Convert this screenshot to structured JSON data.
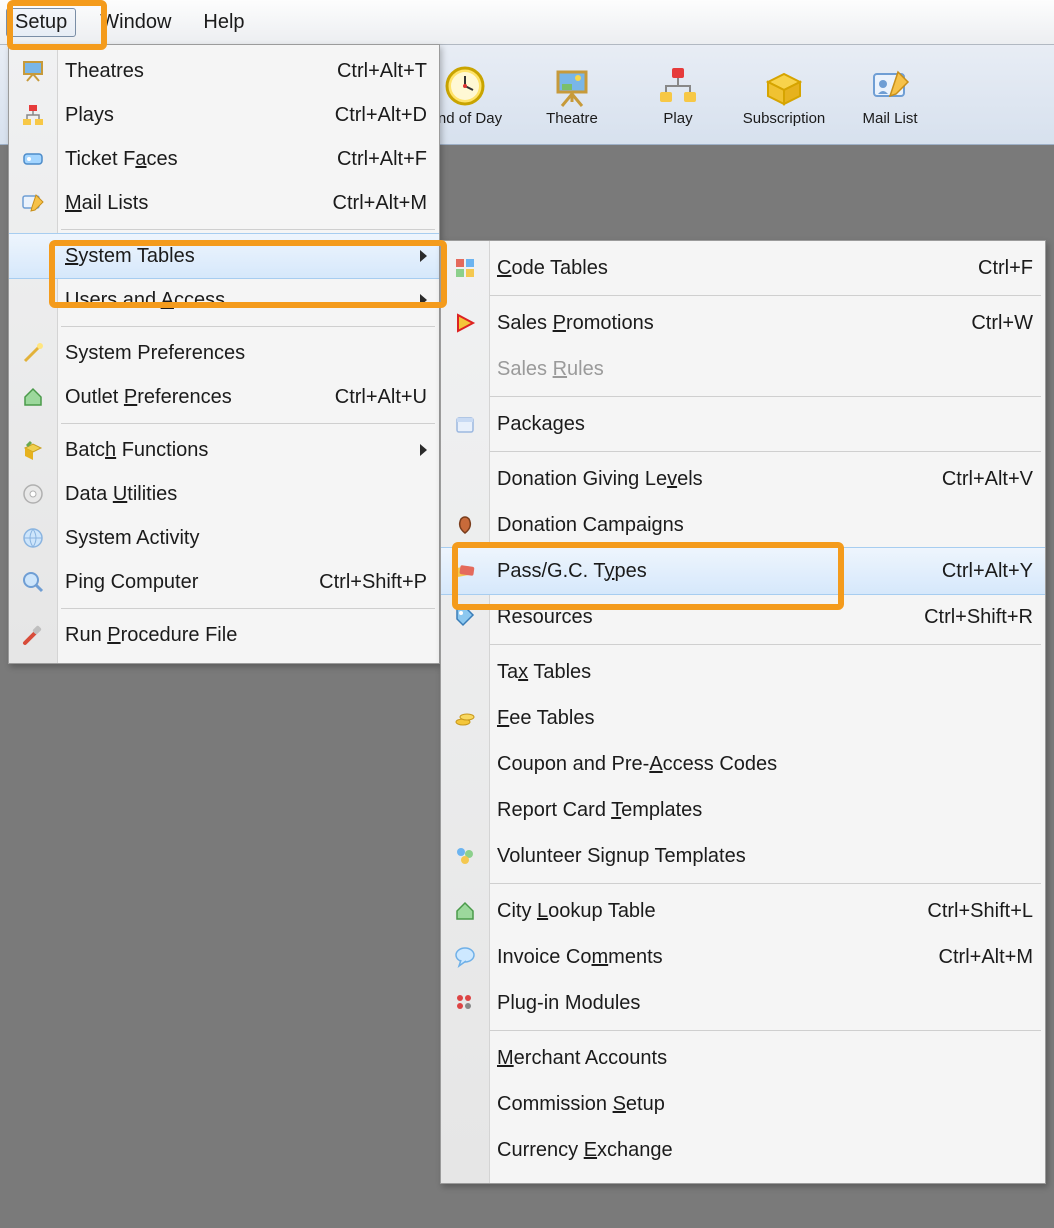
{
  "menubar": {
    "setup": "Setup",
    "window": "Window",
    "help": "Help"
  },
  "toolbar": {
    "end_of_day": "End of Day",
    "theatre": "Theatre",
    "play": "Play",
    "subscription": "Subscription",
    "mail_list": "Mail List"
  },
  "menu1": {
    "theatres": {
      "label": "Theatres",
      "accel": "Ctrl+Alt+T"
    },
    "plays": {
      "label": "Plays",
      "accel": "Ctrl+Alt+D"
    },
    "ticket_faces": {
      "label": "Ticket Faces",
      "accel": "Ctrl+Alt+F"
    },
    "mail_lists": {
      "label": "Mail Lists",
      "accel": "Ctrl+Alt+M"
    },
    "system_tables": {
      "label": "System Tables"
    },
    "users_access": {
      "label": "Users and Access"
    },
    "sys_prefs": {
      "label": "System Preferences"
    },
    "outlet_prefs": {
      "label": "Outlet Preferences",
      "accel": "Ctrl+Alt+U"
    },
    "batch_fn": {
      "label": "Batch Functions"
    },
    "data_util": {
      "label": "Data Utilities"
    },
    "sys_activity": {
      "label": "System Activity"
    },
    "ping": {
      "label": "Ping Computer",
      "accel": "Ctrl+Shift+P"
    },
    "run_proc": {
      "label": "Run Procedure File"
    }
  },
  "menu2": {
    "code_tables": {
      "label": "Code Tables",
      "accel": "Ctrl+F"
    },
    "sales_promo": {
      "label": "Sales Promotions",
      "accel": "Ctrl+W"
    },
    "sales_rules": {
      "label": "Sales Rules"
    },
    "packages": {
      "label": "Packages"
    },
    "donation_levels": {
      "label": "Donation Giving Levels",
      "accel": "Ctrl+Alt+V"
    },
    "donation_camp": {
      "label": "Donation Campaigns"
    },
    "pass_types": {
      "label": "Pass/G.C. Types",
      "accel": "Ctrl+Alt+Y"
    },
    "resources": {
      "label": "Resources",
      "accel": "Ctrl+Shift+R"
    },
    "tax_tables": {
      "label": "Tax Tables"
    },
    "fee_tables": {
      "label": "Fee Tables"
    },
    "coupon": {
      "label": "Coupon and Pre-Access Codes"
    },
    "report_card": {
      "label": "Report Card Templates"
    },
    "volunteer": {
      "label": "Volunteer Signup Templates"
    },
    "city_lookup": {
      "label": "City Lookup Table",
      "accel": "Ctrl+Shift+L"
    },
    "invoice_comm": {
      "label": "Invoice Comments",
      "accel": "Ctrl+Alt+M"
    },
    "plugin": {
      "label": "Plug-in Modules"
    },
    "merchant": {
      "label": "Merchant Accounts"
    },
    "commission": {
      "label": "Commission Setup"
    },
    "currency": {
      "label": "Currency Exchange"
    }
  },
  "highlights": {
    "color": "#f49b1c",
    "targets": [
      "setup-menu",
      "system-tables-item",
      "pass-gc-types-item"
    ]
  }
}
